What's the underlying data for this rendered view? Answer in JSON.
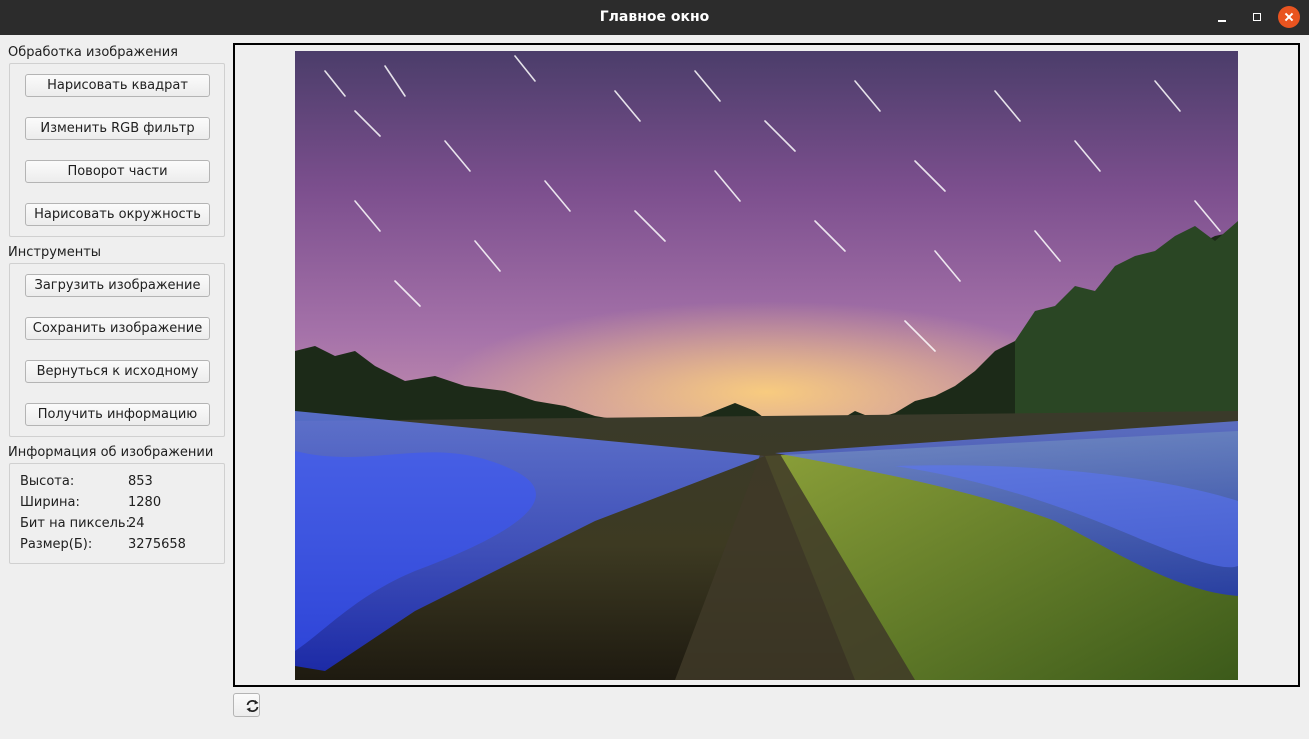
{
  "window": {
    "title": "Главное окно"
  },
  "processing": {
    "label": "Обработка изображения",
    "buttons": [
      "Нарисовать квадрат",
      "Изменить RGB фильтр",
      "Поворот части",
      "Нарисовать окружность"
    ]
  },
  "tools": {
    "label": "Инструменты",
    "buttons": [
      "Загрузить изображение",
      "Сохранить изображение",
      "Вернуться к исходному",
      "Получить информацию"
    ]
  },
  "info": {
    "label": "Информация об изображении",
    "rows": [
      {
        "key": "Высота:",
        "value": "853"
      },
      {
        "key": "Ширина:",
        "value": "1280"
      },
      {
        "key": "Бит на пиксель:",
        "value": "24"
      },
      {
        "key": "Размер(Б):",
        "value": "3275658"
      }
    ]
  },
  "icons": {
    "minimize": "minimize-icon",
    "maximize": "maximize-icon",
    "close": "close-icon",
    "refresh": "refresh-icon"
  },
  "colors": {
    "titlebar": "#2c2c2c",
    "close_button": "#e95420",
    "window_bg": "#efefef"
  }
}
